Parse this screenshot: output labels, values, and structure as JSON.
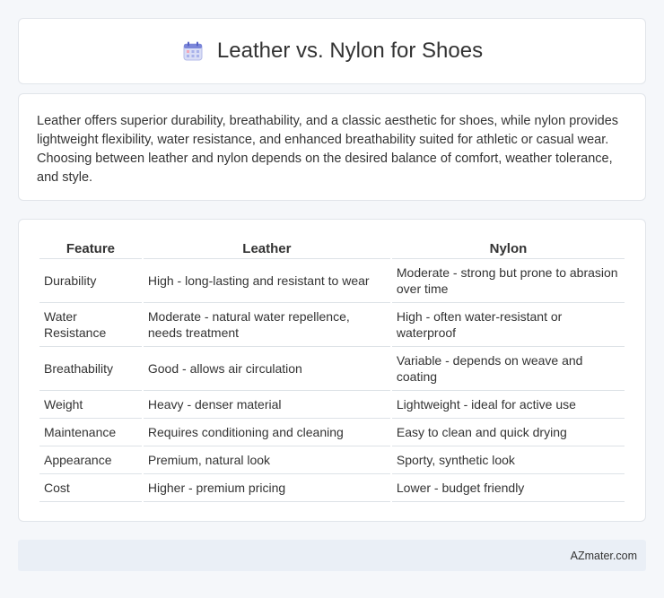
{
  "header": {
    "title": "Leather vs. Nylon for Shoes",
    "icon": "calendar-icon"
  },
  "summary": {
    "text": "Leather offers superior durability, breathability, and a classic aesthetic for shoes, while nylon provides lightweight flexibility, water resistance, and enhanced breathability suited for athletic or casual wear. Choosing between leather and nylon depends on the desired balance of comfort, weather tolerance, and style."
  },
  "table": {
    "headers": [
      "Feature",
      "Leather",
      "Nylon"
    ],
    "rows": [
      [
        "Durability",
        "High - long-lasting and resistant to wear",
        "Moderate - strong but prone to abrasion over time"
      ],
      [
        "Water Resistance",
        "Moderate - natural water repellence, needs treatment",
        "High - often water-resistant or waterproof"
      ],
      [
        "Breathability",
        "Good - allows air circulation",
        "Variable - depends on weave and coating"
      ],
      [
        "Weight",
        "Heavy - denser material",
        "Lightweight - ideal for active use"
      ],
      [
        "Maintenance",
        "Requires conditioning and cleaning",
        "Easy to clean and quick drying"
      ],
      [
        "Appearance",
        "Premium, natural look",
        "Sporty, synthetic look"
      ],
      [
        "Cost",
        "Higher - premium pricing",
        "Lower - budget friendly"
      ]
    ]
  },
  "footer": {
    "brand": "AZmater.com"
  },
  "colors": {
    "background": "#f5f7fa",
    "card": "#ffffff",
    "footer": "#eaeff6",
    "text": "#333333"
  }
}
